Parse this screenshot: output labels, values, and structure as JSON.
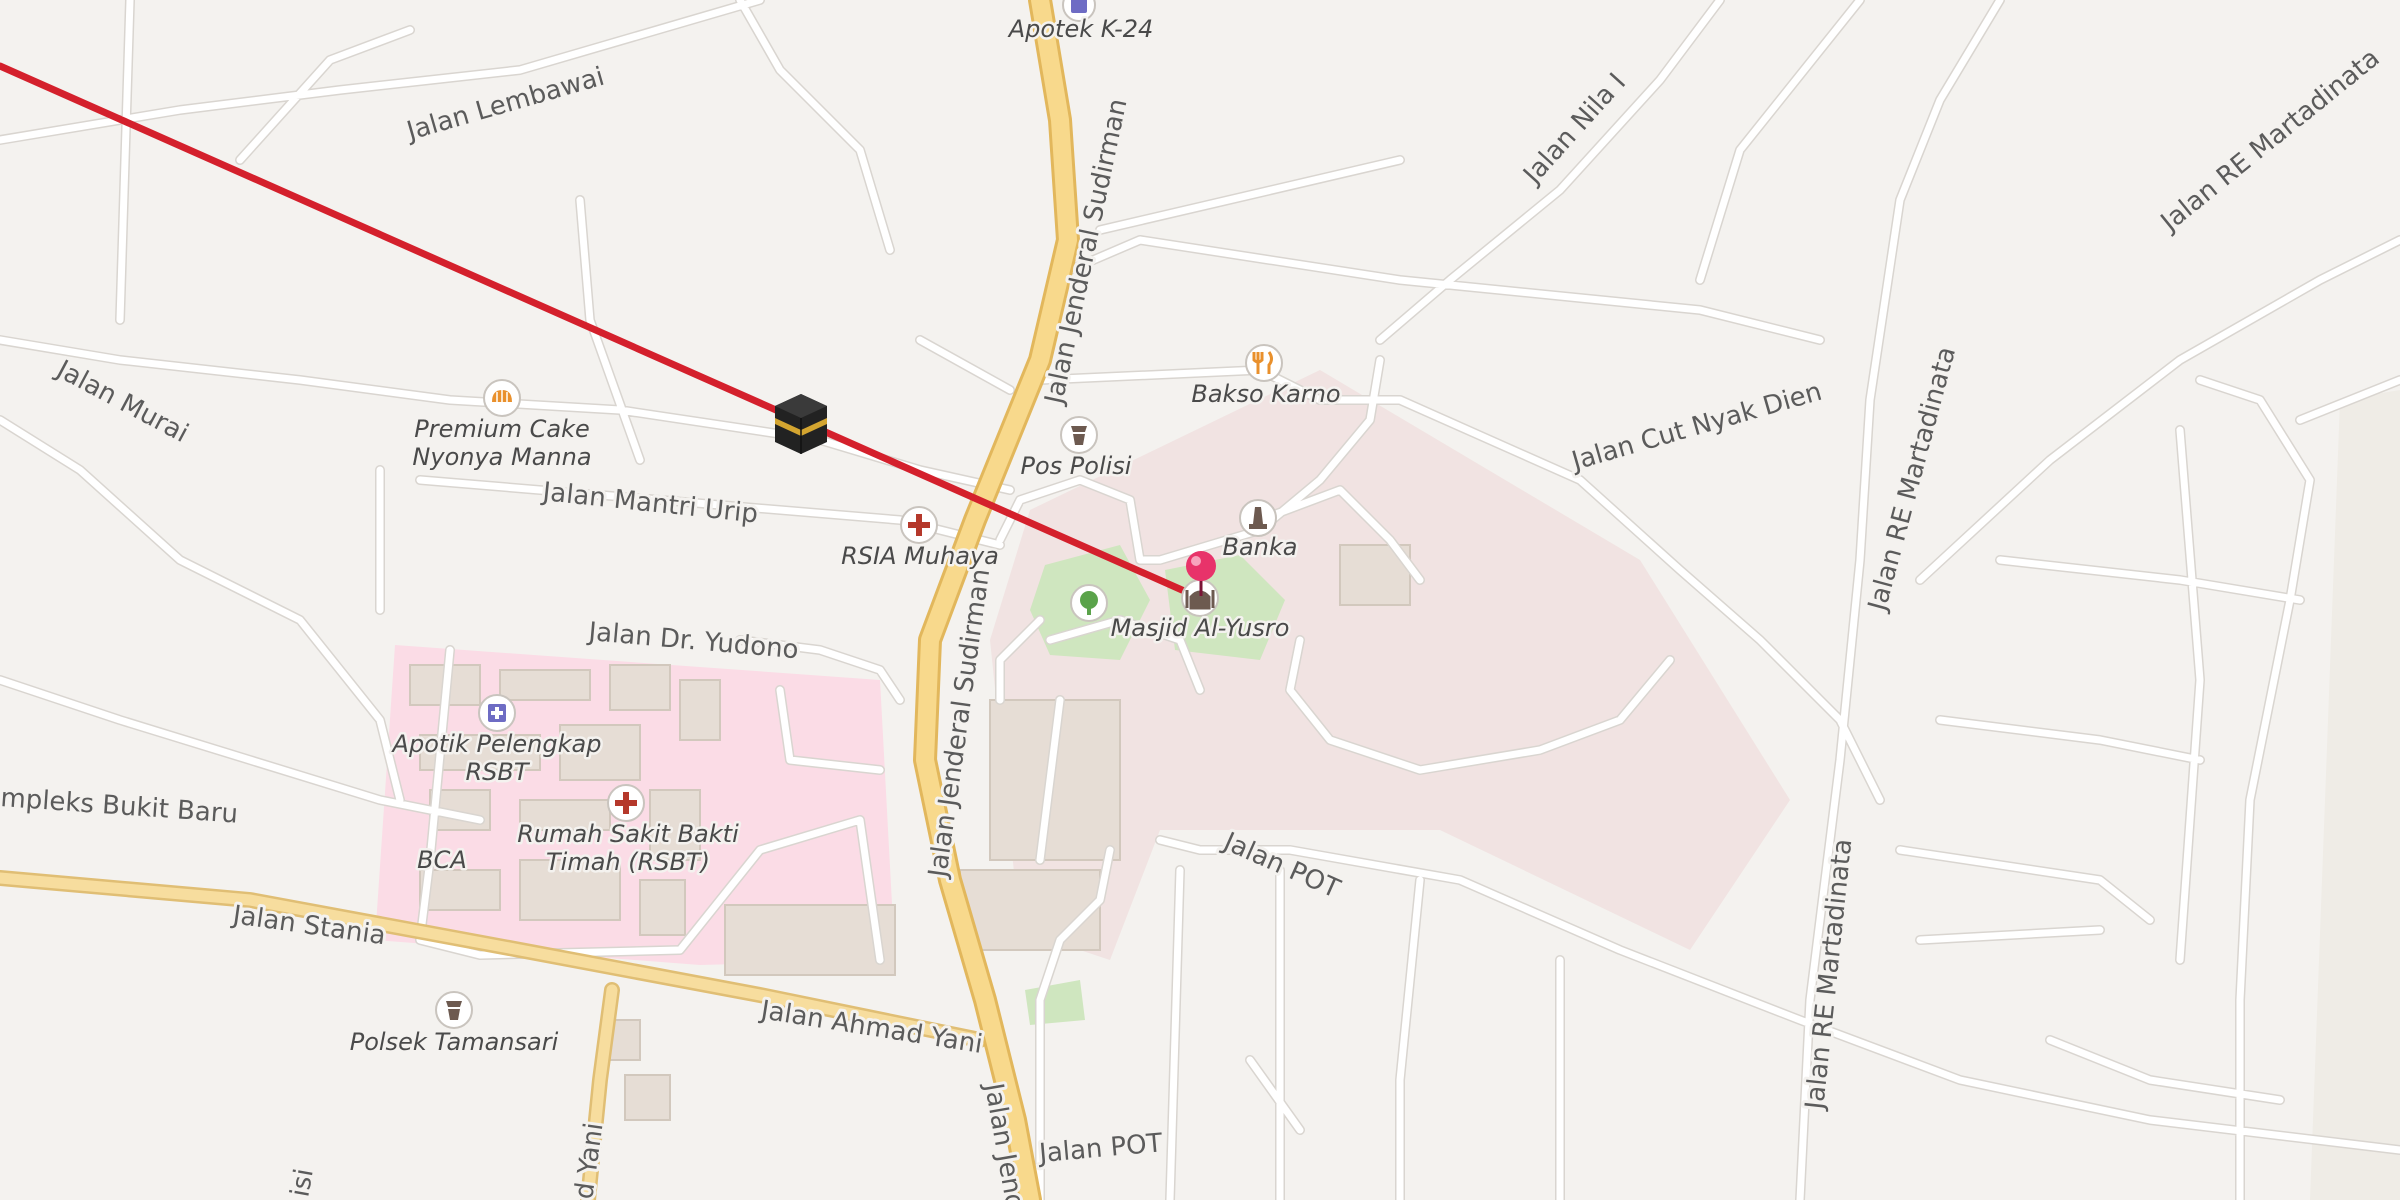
{
  "colors": {
    "background": "#f4f2ef",
    "primary_road": "#f8d98c",
    "hospital_area": "#fbdce6",
    "park": "#cfe6bf",
    "qibla_line": "#d4202c",
    "location_pin": "#e8336a"
  },
  "streets": {
    "lembawai": "Jalan Lembawai",
    "murai": "Jalan Murai",
    "mantri_urip": "Jalan Mantri Urip",
    "dr_yudono": "Jalan Dr. Yudono",
    "komplek_bukit_baru": "mpleks Bukit Baru",
    "stania": "Jalan Stania",
    "ahmad_yani": "Jalan Ahmad Yani",
    "sudirman_1": "Jalan Jenderal Sudirman",
    "sudirman_2": "Jalan Jenderal Sudirman",
    "sudirman_3": "Jalan Jend",
    "pot_1": "Jalan POT",
    "pot_2": "Jalan POT",
    "nila": "Jalan Nila I",
    "cut_nyak_dien": "Jalan Cut Nyak Dien",
    "re_martadinata_1": "Jalan RE Martadinata",
    "re_martadinata_2": "Jalan RE Martadinata",
    "re_martadinata_3": "Jalan RE Martadinata",
    "bottom_1": "d Yani",
    "bottom_2": "isi"
  },
  "pois": {
    "apotek_k24": {
      "name": "Apotek K-24",
      "icon": "pharmacy-icon"
    },
    "premium_cake_1": {
      "name": "Premium Cake",
      "icon": "bakery-icon"
    },
    "premium_cake_2": "Nyonya Manna",
    "pos_polisi": {
      "name": "Pos Polisi",
      "icon": "police-icon"
    },
    "bakso_karno": {
      "name": "Bakso Karno",
      "icon": "restaurant-icon"
    },
    "rsia_muhaya": {
      "name": "RSIA Muhaya",
      "icon": "hospital-icon"
    },
    "banka": {
      "name": "Banka",
      "icon": "monument-icon"
    },
    "masjid": {
      "name": "Masjid Al-Yusro",
      "icon": "mosque-icon"
    },
    "apotik_1": {
      "name": "Apotik Pelengkap",
      "icon": "pharmacy-icon"
    },
    "apotik_2": "RSBT",
    "rumah_sakit_1": {
      "name": "Rumah Sakit Bakti",
      "icon": "hospital-icon"
    },
    "rumah_sakit_2": "Timah (RSBT)",
    "bca": "BCA",
    "polsek": {
      "name": "Polsek Tamansari",
      "icon": "police-icon"
    }
  },
  "markers": {
    "kaaba": "kaaba-icon",
    "current_location": "location-pin-icon",
    "park": "tree-icon"
  }
}
